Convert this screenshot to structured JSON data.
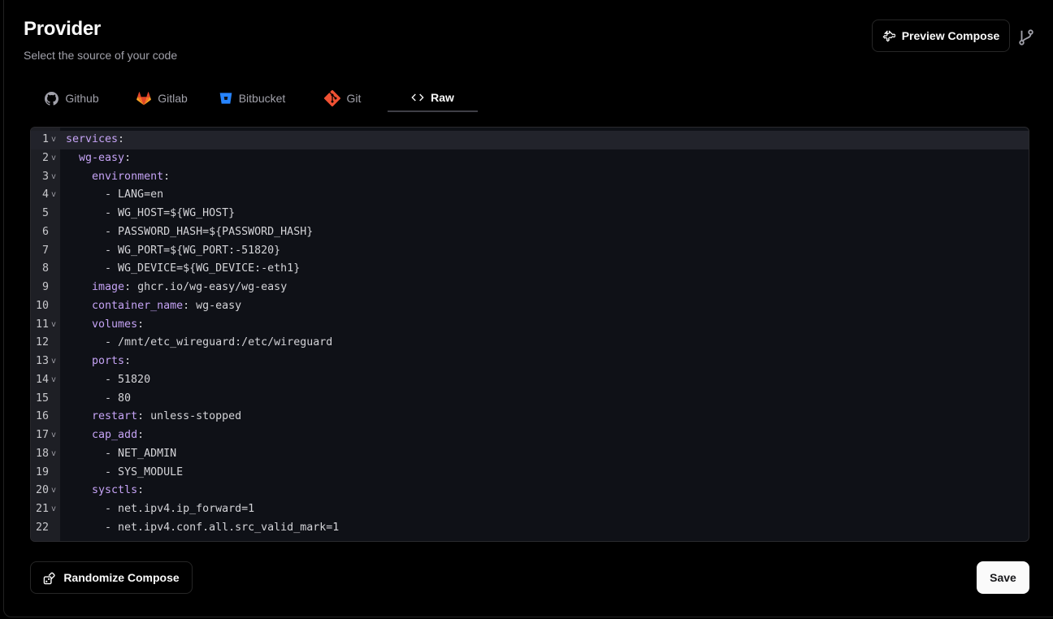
{
  "header": {
    "title": "Provider",
    "subtitle": "Select the source of your code",
    "preview_label": "Preview Compose"
  },
  "tabs": [
    {
      "label": "Github",
      "icon": "github-icon",
      "active": false
    },
    {
      "label": "Gitlab",
      "icon": "gitlab-icon",
      "active": false
    },
    {
      "label": "Bitbucket",
      "icon": "bitbucket-icon",
      "active": false
    },
    {
      "label": "Git",
      "icon": "git-icon",
      "active": false
    },
    {
      "label": "Raw",
      "icon": "code-icon",
      "active": true
    }
  ],
  "editor": {
    "lines": [
      {
        "text": "services:",
        "fold": true
      },
      {
        "text": "  wg-easy:",
        "fold": true
      },
      {
        "text": "    environment:",
        "fold": true
      },
      {
        "text": "      - LANG=en",
        "fold": true
      },
      {
        "text": "      - WG_HOST=${WG_HOST}",
        "fold": false
      },
      {
        "text": "      - PASSWORD_HASH=${PASSWORD_HASH}",
        "fold": false
      },
      {
        "text": "      - WG_PORT=${WG_PORT:-51820}",
        "fold": false
      },
      {
        "text": "      - WG_DEVICE=${WG_DEVICE:-eth1}",
        "fold": false
      },
      {
        "text": "    image: ghcr.io/wg-easy/wg-easy",
        "fold": false
      },
      {
        "text": "    container_name: wg-easy",
        "fold": false
      },
      {
        "text": "    volumes:",
        "fold": true
      },
      {
        "text": "      - /mnt/etc_wireguard:/etc/wireguard",
        "fold": false
      },
      {
        "text": "    ports:",
        "fold": true
      },
      {
        "text": "      - 51820",
        "fold": true
      },
      {
        "text": "      - 80",
        "fold": false
      },
      {
        "text": "    restart: unless-stopped",
        "fold": false
      },
      {
        "text": "    cap_add:",
        "fold": true
      },
      {
        "text": "      - NET_ADMIN",
        "fold": true
      },
      {
        "text": "      - SYS_MODULE",
        "fold": false
      },
      {
        "text": "    sysctls:",
        "fold": true
      },
      {
        "text": "      - net.ipv4.ip_forward=1",
        "fold": true
      },
      {
        "text": "      - net.ipv4.conf.all.src_valid_mark=1",
        "fold": false
      }
    ],
    "active_line": 1,
    "fold_glyph": "v"
  },
  "footer": {
    "randomize_label": "Randomize Compose",
    "save_label": "Save"
  }
}
